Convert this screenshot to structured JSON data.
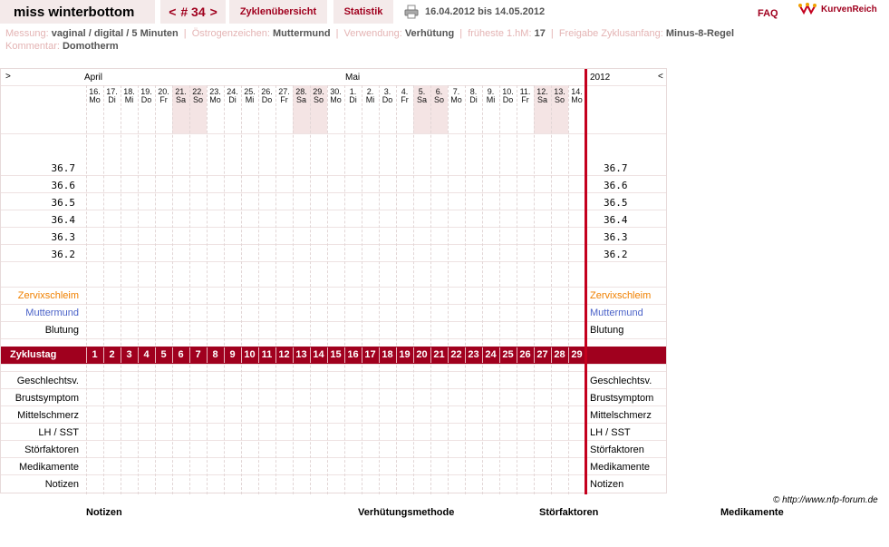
{
  "header": {
    "cycle_name": "miss winterbottom",
    "nav_prev": "<",
    "cycle_number": "# 34",
    "nav_next": ">",
    "tab_overview": "Zyklenübersicht",
    "tab_statistics": "Statistik",
    "date_range": "16.04.2012 bis 14.05.2012",
    "faq": "FAQ",
    "logo_text": "KurvenReich"
  },
  "info": {
    "messung_label": "Messung:",
    "messung_value": "vaginal / digital / 5 Minuten",
    "oestrogen_label": "Östrogenzeichen:",
    "oestrogen_value": "Muttermund",
    "verwendung_label": "Verwendung:",
    "verwendung_value": "Verhütung",
    "hm_label": "früheste 1.hM:",
    "hm_value": "17",
    "freigabe_label": "Freigabe Zyklusanfang:",
    "freigabe_value": "Minus-8-Regel",
    "kommentar_label": "Kommentar:",
    "kommentar_value": "Domotherm"
  },
  "chart": {
    "arrow_left": ">",
    "arrow_right": "<",
    "month_april": "April",
    "month_mai": "Mai",
    "year": "2012",
    "days": [
      {
        "d": "16.",
        "w": "Mo",
        "we": false
      },
      {
        "d": "17.",
        "w": "Di",
        "we": false
      },
      {
        "d": "18.",
        "w": "Mi",
        "we": false
      },
      {
        "d": "19.",
        "w": "Do",
        "we": false
      },
      {
        "d": "20.",
        "w": "Fr",
        "we": false
      },
      {
        "d": "21.",
        "w": "Sa",
        "we": true
      },
      {
        "d": "22.",
        "w": "So",
        "we": true
      },
      {
        "d": "23.",
        "w": "Mo",
        "we": false
      },
      {
        "d": "24.",
        "w": "Di",
        "we": false
      },
      {
        "d": "25.",
        "w": "Mi",
        "we": false
      },
      {
        "d": "26.",
        "w": "Do",
        "we": false
      },
      {
        "d": "27.",
        "w": "Fr",
        "we": false
      },
      {
        "d": "28.",
        "w": "Sa",
        "we": true
      },
      {
        "d": "29.",
        "w": "So",
        "we": true
      },
      {
        "d": "30.",
        "w": "Mo",
        "we": false
      },
      {
        "d": "1.",
        "w": "Di",
        "we": false
      },
      {
        "d": "2.",
        "w": "Mi",
        "we": false
      },
      {
        "d": "3.",
        "w": "Do",
        "we": false
      },
      {
        "d": "4.",
        "w": "Fr",
        "we": false
      },
      {
        "d": "5.",
        "w": "Sa",
        "we": true
      },
      {
        "d": "6.",
        "w": "So",
        "we": true
      },
      {
        "d": "7.",
        "w": "Mo",
        "we": false
      },
      {
        "d": "8.",
        "w": "Di",
        "we": false
      },
      {
        "d": "9.",
        "w": "Mi",
        "we": false
      },
      {
        "d": "10.",
        "w": "Do",
        "we": false
      },
      {
        "d": "11.",
        "w": "Fr",
        "we": false
      },
      {
        "d": "12.",
        "w": "Sa",
        "we": true
      },
      {
        "d": "13.",
        "w": "So",
        "we": true
      },
      {
        "d": "14.",
        "w": "Mo",
        "we": false
      }
    ],
    "temperatures": [
      "36.7",
      "36.6",
      "36.5",
      "36.4",
      "36.3",
      "36.2"
    ],
    "row_zervix": "Zervixschleim",
    "row_muttermund": "Muttermund",
    "row_blutung": "Blutung",
    "zyklustag_label": "Zyklustag",
    "cycle_days": [
      "1",
      "2",
      "3",
      "4",
      "5",
      "6",
      "7",
      "8",
      "9",
      "10",
      "11",
      "12",
      "13",
      "14",
      "15",
      "16",
      "17",
      "18",
      "19",
      "20",
      "21",
      "22",
      "23",
      "24",
      "25",
      "26",
      "27",
      "28",
      "29"
    ],
    "lower_rows": [
      "Geschlechtsv.",
      "Brustsymptom",
      "Mittelschmerz",
      "LH / SST",
      "Störfaktoren",
      "Medikamente",
      "Notizen"
    ]
  },
  "colors": {
    "accent": "#a0001e",
    "weekend": "#f4e4e4",
    "zervix": "#f08000",
    "muttermund": "#4a62c8"
  },
  "footer": {
    "copyright": "© http://www.nfp-forum.de",
    "legend_notizen": "Notizen",
    "legend_verhuetung": "Verhütungsmethode",
    "legend_stoerfaktoren": "Störfaktoren",
    "legend_medikamente": "Medikamente"
  }
}
